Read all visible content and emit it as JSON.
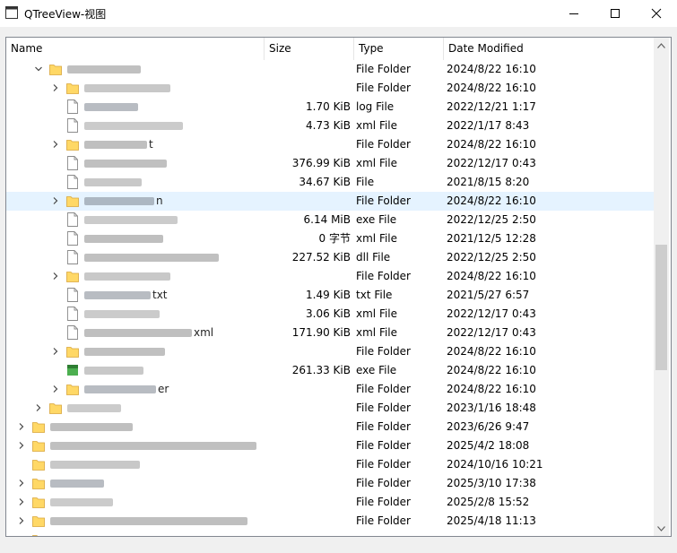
{
  "window": {
    "title": "QTreeView-视图"
  },
  "columns": {
    "name": "Name",
    "size": "Size",
    "type": "Type",
    "date": "Date Modified"
  },
  "rows": [
    {
      "level": 2,
      "expander": "expanded",
      "icon": "folder",
      "name": "",
      "size": "",
      "type": "File Folder",
      "date": "2024/8/22 16:10"
    },
    {
      "level": 3,
      "expander": "collapsed",
      "icon": "folder",
      "name": "",
      "size": "",
      "type": "File Folder",
      "date": "2024/8/22 16:10"
    },
    {
      "level": 3,
      "expander": "none",
      "icon": "file",
      "name": "",
      "size": "1.70 KiB",
      "type": "log File",
      "date": "2022/12/21 1:17"
    },
    {
      "level": 3,
      "expander": "none",
      "icon": "file",
      "name": "",
      "size": "4.73 KiB",
      "type": "xml File",
      "date": "2022/1/17 8:43"
    },
    {
      "level": 3,
      "expander": "collapsed",
      "icon": "folder",
      "name": "t",
      "size": "",
      "type": "File Folder",
      "date": "2024/8/22 16:10"
    },
    {
      "level": 3,
      "expander": "none",
      "icon": "file",
      "name": "",
      "size": "376.99 KiB",
      "type": "xml File",
      "date": "2022/12/17 0:43"
    },
    {
      "level": 3,
      "expander": "none",
      "icon": "file",
      "name": "",
      "size": "34.67 KiB",
      "type": "File",
      "date": "2021/8/15 8:20"
    },
    {
      "level": 3,
      "expander": "collapsed",
      "icon": "folder",
      "name": "n",
      "size": "",
      "type": "File Folder",
      "date": "2024/8/22 16:10",
      "selected": true
    },
    {
      "level": 3,
      "expander": "none",
      "icon": "file",
      "name": "",
      "size": "6.14 MiB",
      "type": "exe File",
      "date": "2022/12/25 2:50"
    },
    {
      "level": 3,
      "expander": "none",
      "icon": "file",
      "name": "",
      "size": "0 字节",
      "type": "xml File",
      "date": "2021/12/5 12:28"
    },
    {
      "level": 3,
      "expander": "none",
      "icon": "file",
      "name": "",
      "size": "227.52 KiB",
      "type": "dll File",
      "date": "2022/12/25 2:50"
    },
    {
      "level": 3,
      "expander": "collapsed",
      "icon": "folder",
      "name": "",
      "size": "",
      "type": "File Folder",
      "date": "2024/8/22 16:10"
    },
    {
      "level": 3,
      "expander": "none",
      "icon": "file",
      "name": "txt",
      "size": "1.49 KiB",
      "type": "txt File",
      "date": "2021/5/27 6:57"
    },
    {
      "level": 3,
      "expander": "none",
      "icon": "file",
      "name": "",
      "size": "3.06 KiB",
      "type": "xml File",
      "date": "2022/12/17 0:43"
    },
    {
      "level": 3,
      "expander": "none",
      "icon": "file",
      "name": "xml",
      "size": "171.90 KiB",
      "type": "xml File",
      "date": "2022/12/17 0:43"
    },
    {
      "level": 3,
      "expander": "collapsed",
      "icon": "folder",
      "name": "",
      "size": "",
      "type": "File Folder",
      "date": "2024/8/22 16:10"
    },
    {
      "level": 3,
      "expander": "none",
      "icon": "exe",
      "name": "",
      "size": "261.33 KiB",
      "type": "exe File",
      "date": "2024/8/22 16:10"
    },
    {
      "level": 3,
      "expander": "collapsed",
      "icon": "folder",
      "name": "er",
      "size": "",
      "type": "File Folder",
      "date": "2024/8/22 16:10"
    },
    {
      "level": 2,
      "expander": "collapsed",
      "icon": "folder",
      "name": "",
      "size": "",
      "type": "File Folder",
      "date": "2023/1/16 18:48"
    },
    {
      "level": 1,
      "expander": "collapsed",
      "icon": "folder",
      "name": "",
      "size": "",
      "type": "File Folder",
      "date": "2023/6/26 9:47"
    },
    {
      "level": 1,
      "expander": "collapsed",
      "icon": "folder",
      "name": "",
      "size": "",
      "type": "File Folder",
      "date": "2025/4/2 18:08"
    },
    {
      "level": 1,
      "expander": "none",
      "icon": "folder",
      "name": "",
      "size": "",
      "type": "File Folder",
      "date": "2024/10/16 10:21"
    },
    {
      "level": 1,
      "expander": "collapsed",
      "icon": "folder",
      "name": "",
      "size": "",
      "type": "File Folder",
      "date": "2025/3/10 17:38"
    },
    {
      "level": 1,
      "expander": "collapsed",
      "icon": "folder",
      "name": "",
      "size": "",
      "type": "File Folder",
      "date": "2025/2/8 15:52"
    },
    {
      "level": 1,
      "expander": "collapsed",
      "icon": "folder",
      "name": "",
      "size": "",
      "type": "File Folder",
      "date": "2025/4/18 11:13"
    },
    {
      "level": 1,
      "expander": "collapsed",
      "icon": "folder",
      "name": "",
      "size": "",
      "type": "",
      "date": ""
    }
  ],
  "colors": {
    "selection": "#e5f3ff",
    "folder": "#ffd866",
    "border": "#828790",
    "scroll_thumb": "#cdcdcd"
  },
  "icons": {
    "window": "qt-window-icon",
    "minimize": "minimize-icon",
    "maximize": "maximize-icon",
    "close": "close-icon"
  }
}
